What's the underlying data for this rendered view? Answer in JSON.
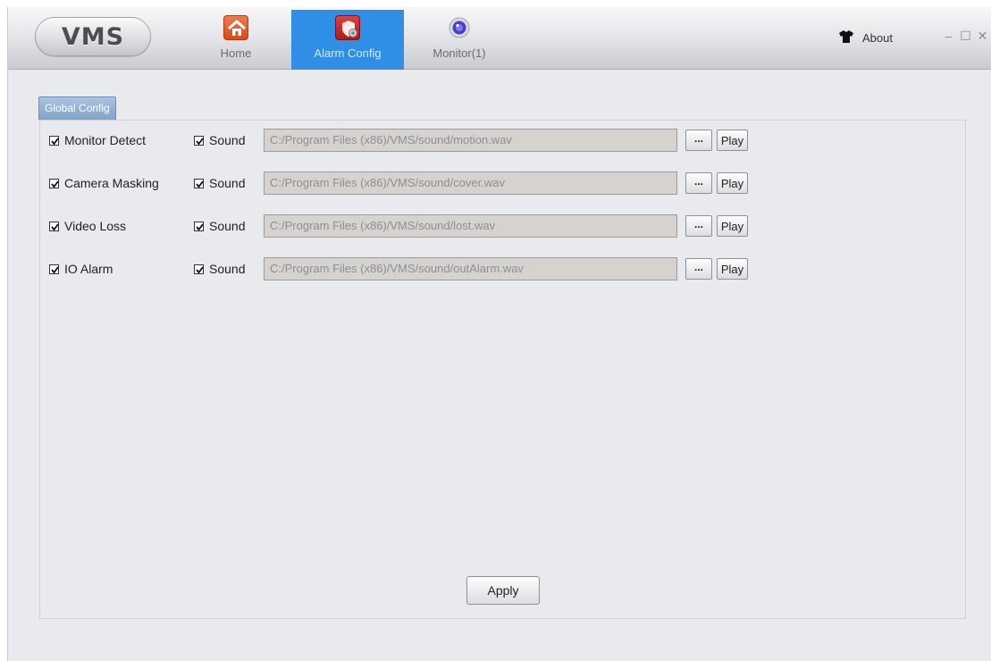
{
  "app": {
    "logo_text": "VMS",
    "nav": [
      {
        "label": "Home",
        "icon": "home-icon",
        "active": false
      },
      {
        "label": "Alarm Config",
        "icon": "alarm-config-icon",
        "active": true
      },
      {
        "label": "Monitor(1)",
        "icon": "monitor-icon",
        "active": false
      }
    ],
    "about_label": "About",
    "accent_color": "#2f8ee5"
  },
  "config": {
    "tab_label": "Global Config",
    "sound_label": "Sound",
    "browse_label": "...",
    "play_label": "Play",
    "apply_label": "Apply",
    "rows": [
      {
        "name": "Monitor Detect",
        "enabled": true,
        "sound_enabled": true,
        "path": "C:/Program Files (x86)/VMS/sound/motion.wav"
      },
      {
        "name": "Camera Masking",
        "enabled": true,
        "sound_enabled": true,
        "path": "C:/Program Files (x86)/VMS/sound/cover.wav"
      },
      {
        "name": "Video Loss",
        "enabled": true,
        "sound_enabled": true,
        "path": "C:/Program Files (x86)/VMS/sound/lost.wav"
      },
      {
        "name": "IO Alarm",
        "enabled": true,
        "sound_enabled": true,
        "path": "C:/Program Files (x86)/VMS/sound/outAlarm.wav"
      }
    ]
  }
}
